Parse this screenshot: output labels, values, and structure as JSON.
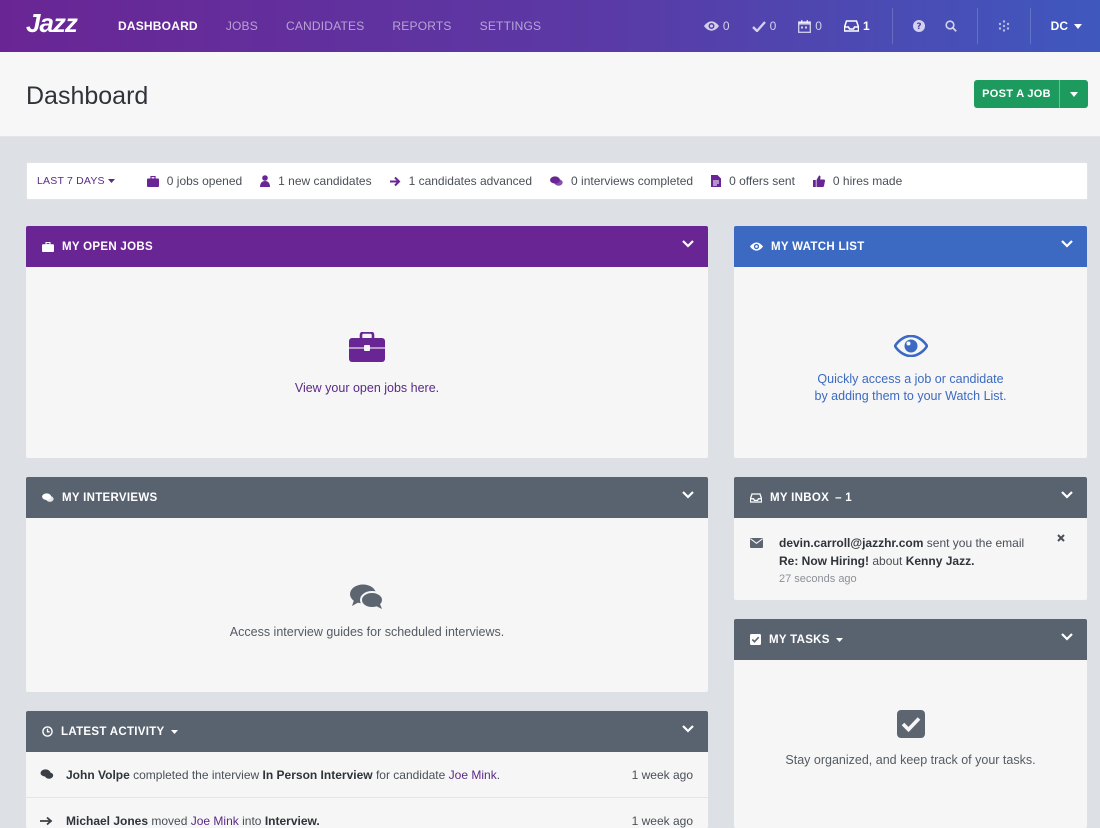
{
  "nav": {
    "logo": "Jazz",
    "links": [
      "DASHBOARD",
      "JOBS",
      "CANDIDATES",
      "REPORTS",
      "SETTINGS"
    ],
    "counters": [
      {
        "icon": "eye-icon",
        "count": "0"
      },
      {
        "icon": "check-icon",
        "count": "0"
      },
      {
        "icon": "calendar-icon",
        "count": "0"
      },
      {
        "icon": "inbox-icon",
        "count": "1"
      }
    ],
    "user_initials": "DC"
  },
  "header": {
    "title": "Dashboard",
    "post_job_label": "POST A JOB"
  },
  "stats": {
    "range_label": "LAST 7 DAYS",
    "items": [
      {
        "icon": "briefcase-icon",
        "text": "0 jobs opened"
      },
      {
        "icon": "user-icon",
        "text": "1 new candidates"
      },
      {
        "icon": "arrow-right-icon",
        "text": "1 candidates advanced"
      },
      {
        "icon": "comments-icon",
        "text": "0 interviews completed"
      },
      {
        "icon": "document-icon",
        "text": "0 offers sent"
      },
      {
        "icon": "thumbs-up-icon",
        "text": "0 hires made"
      }
    ]
  },
  "open_jobs": {
    "title": "MY OPEN JOBS",
    "empty_text": "View your open jobs here."
  },
  "watch_list": {
    "title": "MY WATCH LIST",
    "empty_line1": "Quickly access a job or candidate",
    "empty_line2": "by adding them to your Watch List."
  },
  "interviews": {
    "title": "MY INTERVIEWS",
    "empty_text": "Access interview guides for scheduled interviews."
  },
  "inbox": {
    "title": "MY INBOX",
    "count_suffix": "– 1",
    "item": {
      "sender": "devin.carroll@jazzhr.com",
      "mid": "sent you the email",
      "subject": "Re: Now Hiring!",
      "about": "about",
      "candidate": "Kenny Jazz.",
      "time": "27 seconds ago"
    }
  },
  "tasks": {
    "title": "MY TASKS",
    "empty_text": "Stay organized, and keep track of your tasks."
  },
  "activity": {
    "title": "LATEST ACTIVITY",
    "rows": [
      {
        "actor": "John Volpe",
        "verb": "completed the interview",
        "object": "In Person Interview",
        "mid": "for candidate",
        "link": "Joe Mink",
        "tail": ".",
        "time": "1 week ago"
      },
      {
        "actor": "Michael Jones",
        "verb": "moved",
        "object": "",
        "mid": "",
        "link": "Joe Mink",
        "tail": "into",
        "tail_bold": "Interview.",
        "time": "1 week ago"
      }
    ]
  },
  "colors": {
    "brand_purple": "#6a2594",
    "watch_blue": "#3c6ac2",
    "slate": "#59636f",
    "success_green": "#1d9b5e"
  }
}
